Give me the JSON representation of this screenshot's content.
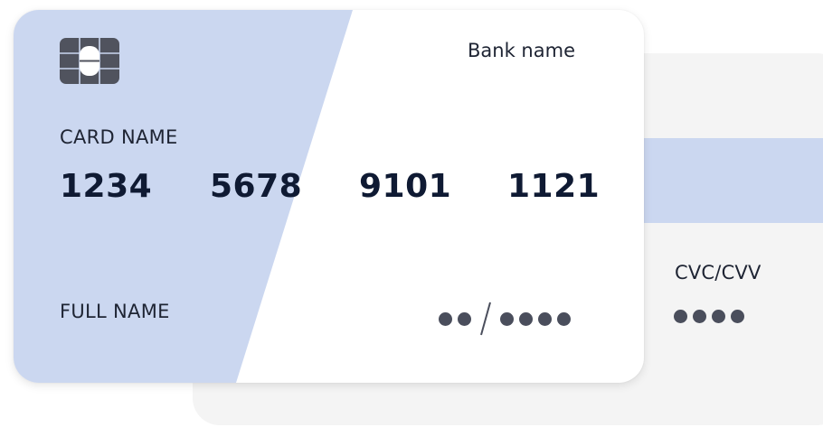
{
  "front_card": {
    "bank_name": "Bank name",
    "card_name_label": "CARD NAME",
    "number_groups": [
      "1234",
      "5678",
      "9101",
      "1121"
    ],
    "full_name_label": "FULL NAME",
    "expiry_month_dots": 2,
    "expiry_year_dots": 4,
    "chip_icon": "chip-icon"
  },
  "back_card": {
    "cvc_label": "CVC/CVV",
    "cvc_dots": 4
  },
  "colors": {
    "accent_blue": "#cbd7f0",
    "card_back_bg": "#f4f4f4",
    "text_dark": "#0f1a33",
    "dot_gray": "#4a4e5c",
    "chip_gray": "#50535e"
  }
}
